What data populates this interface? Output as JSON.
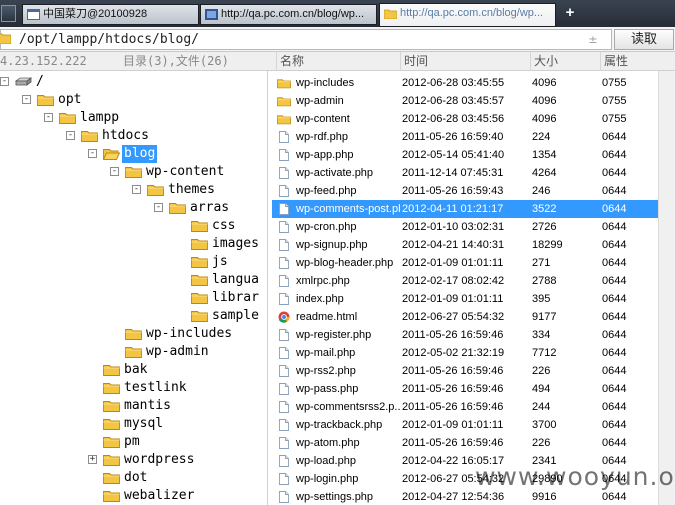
{
  "tabs": [
    {
      "label": "中国菜刀@20100928",
      "active": false
    },
    {
      "label": "http://qa.pc.com.cn/blog/wp...",
      "active": false
    },
    {
      "label": "http://qa.pc.com.cn/blog/wp...",
      "active": true
    }
  ],
  "new_tab_label": "+",
  "path_bar": {
    "value": "/opt/lampp/htdocs/blog/",
    "encoding": "±",
    "read_label": "读取"
  },
  "info": {
    "ip": "4.23.152.222",
    "summary": "目录(3),文件(26)"
  },
  "columns": {
    "name": "名称",
    "time": "时间",
    "size": "大小",
    "attr": "属性"
  },
  "tree": [
    {
      "label": "/",
      "depth": 0,
      "expander": "-",
      "icon": "drive"
    },
    {
      "label": "opt",
      "depth": 1,
      "expander": "-",
      "icon": "folder"
    },
    {
      "label": "lampp",
      "depth": 2,
      "expander": "-",
      "icon": "folder"
    },
    {
      "label": "htdocs",
      "depth": 3,
      "expander": "-",
      "icon": "folder"
    },
    {
      "label": "blog",
      "depth": 4,
      "expander": "-",
      "icon": "folder-open",
      "selected": true
    },
    {
      "label": "wp-content",
      "depth": 5,
      "expander": "-",
      "icon": "folder"
    },
    {
      "label": "themes",
      "depth": 6,
      "expander": "-",
      "icon": "folder"
    },
    {
      "label": "arras",
      "depth": 7,
      "expander": "-",
      "icon": "folder"
    },
    {
      "label": "css",
      "depth": 8,
      "expander": "",
      "icon": "folder"
    },
    {
      "label": "images",
      "depth": 8,
      "expander": "",
      "icon": "folder"
    },
    {
      "label": "js",
      "depth": 8,
      "expander": "",
      "icon": "folder"
    },
    {
      "label": "langua",
      "depth": 8,
      "expander": "",
      "icon": "folder"
    },
    {
      "label": "librar",
      "depth": 8,
      "expander": "",
      "icon": "folder"
    },
    {
      "label": "sample",
      "depth": 8,
      "expander": "",
      "icon": "folder"
    },
    {
      "label": "wp-includes",
      "depth": 5,
      "expander": "",
      "icon": "folder"
    },
    {
      "label": "wp-admin",
      "depth": 5,
      "expander": "",
      "icon": "folder"
    },
    {
      "label": "bak",
      "depth": 4,
      "expander": "",
      "icon": "folder"
    },
    {
      "label": "testlink",
      "depth": 4,
      "expander": "",
      "icon": "folder"
    },
    {
      "label": "mantis",
      "depth": 4,
      "expander": "",
      "icon": "folder"
    },
    {
      "label": "mysql",
      "depth": 4,
      "expander": "",
      "icon": "folder"
    },
    {
      "label": "pm",
      "depth": 4,
      "expander": "",
      "icon": "folder"
    },
    {
      "label": "wordpress",
      "depth": 4,
      "expander": "+",
      "icon": "folder"
    },
    {
      "label": "dot",
      "depth": 4,
      "expander": "",
      "icon": "folder"
    },
    {
      "label": "webalizer",
      "depth": 4,
      "expander": "",
      "icon": "folder"
    }
  ],
  "files": [
    {
      "name": "wp-includes",
      "time": "2012-06-28 03:45:55",
      "size": "4096",
      "attr": "0755",
      "icon": "folder"
    },
    {
      "name": "wp-admin",
      "time": "2012-06-28 03:45:57",
      "size": "4096",
      "attr": "0755",
      "icon": "folder"
    },
    {
      "name": "wp-content",
      "time": "2012-06-28 03:45:56",
      "size": "4096",
      "attr": "0755",
      "icon": "folder"
    },
    {
      "name": "wp-rdf.php",
      "time": "2011-05-26 16:59:40",
      "size": "224",
      "attr": "0644",
      "icon": "file"
    },
    {
      "name": "wp-app.php",
      "time": "2012-05-14 05:41:40",
      "size": "1354",
      "attr": "0644",
      "icon": "file"
    },
    {
      "name": "wp-activate.php",
      "time": "2011-12-14 07:45:31",
      "size": "4264",
      "attr": "0644",
      "icon": "file"
    },
    {
      "name": "wp-feed.php",
      "time": "2011-05-26 16:59:43",
      "size": "246",
      "attr": "0644",
      "icon": "file"
    },
    {
      "name": "wp-comments-post.php",
      "time": "2012-04-11 01:21:17",
      "size": "3522",
      "attr": "0644",
      "icon": "file",
      "selected": true
    },
    {
      "name": "wp-cron.php",
      "time": "2012-01-10 03:02:31",
      "size": "2726",
      "attr": "0644",
      "icon": "file"
    },
    {
      "name": "wp-signup.php",
      "time": "2012-04-21 14:40:31",
      "size": "18299",
      "attr": "0644",
      "icon": "file"
    },
    {
      "name": "wp-blog-header.php",
      "time": "2012-01-09 01:01:11",
      "size": "271",
      "attr": "0644",
      "icon": "file"
    },
    {
      "name": "xmlrpc.php",
      "time": "2012-02-17 08:02:42",
      "size": "2788",
      "attr": "0644",
      "icon": "file"
    },
    {
      "name": "index.php",
      "time": "2012-01-09 01:01:11",
      "size": "395",
      "attr": "0644",
      "icon": "file"
    },
    {
      "name": "readme.html",
      "time": "2012-06-27 05:54:32",
      "size": "9177",
      "attr": "0644",
      "icon": "chrome"
    },
    {
      "name": "wp-register.php",
      "time": "2011-05-26 16:59:46",
      "size": "334",
      "attr": "0644",
      "icon": "file"
    },
    {
      "name": "wp-mail.php",
      "time": "2012-05-02 21:32:19",
      "size": "7712",
      "attr": "0644",
      "icon": "file"
    },
    {
      "name": "wp-rss2.php",
      "time": "2011-05-26 16:59:46",
      "size": "226",
      "attr": "0644",
      "icon": "file"
    },
    {
      "name": "wp-pass.php",
      "time": "2011-05-26 16:59:46",
      "size": "494",
      "attr": "0644",
      "icon": "file"
    },
    {
      "name": "wp-commentsrss2.p...",
      "time": "2011-05-26 16:59:46",
      "size": "244",
      "attr": "0644",
      "icon": "file"
    },
    {
      "name": "wp-trackback.php",
      "time": "2012-01-09 01:01:11",
      "size": "3700",
      "attr": "0644",
      "icon": "file"
    },
    {
      "name": "wp-atom.php",
      "time": "2011-05-26 16:59:46",
      "size": "226",
      "attr": "0644",
      "icon": "file"
    },
    {
      "name": "wp-load.php",
      "time": "2012-04-22 16:05:17",
      "size": "2341",
      "attr": "0644",
      "icon": "file"
    },
    {
      "name": "wp-login.php",
      "time": "2012-06-27 05:54:32",
      "size": "29890",
      "attr": "0644",
      "icon": "file"
    },
    {
      "name": "wp-settings.php",
      "time": "2012-04-27 12:54:36",
      "size": "9916",
      "attr": "0644",
      "icon": "file"
    }
  ],
  "watermark": "www.wooyun.org",
  "colors": {
    "selection": "#3399ff",
    "folder": "#f4c542",
    "tab_active_text": "#5a7ba8"
  }
}
